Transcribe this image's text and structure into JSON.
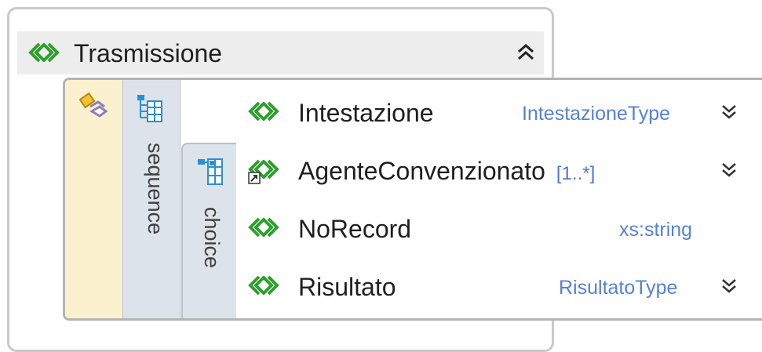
{
  "element": {
    "name": "Trasmissione",
    "icon": "element-icon",
    "collapse_icon": "chevron-double-up-icon"
  },
  "compositors": {
    "sequence_label": "sequence",
    "choice_label": "choice"
  },
  "items": [
    {
      "name": "Intestazione",
      "multiplicity": "",
      "type": "IntestazioneType",
      "expandable": true
    },
    {
      "name": "AgenteConvenzionato",
      "multiplicity": "[1..*]",
      "type": "",
      "expandable": true
    },
    {
      "name": "NoRecord",
      "multiplicity": "",
      "type": "xs:string",
      "expandable": false
    },
    {
      "name": "Risultato",
      "multiplicity": "",
      "type": "RisultatoType",
      "expandable": true
    }
  ],
  "colors": {
    "element_icon": "#2f9e2f",
    "type_text": "#5581d6",
    "gutter": "#fcf1cf",
    "compositor_bg": "#dde3ea"
  }
}
